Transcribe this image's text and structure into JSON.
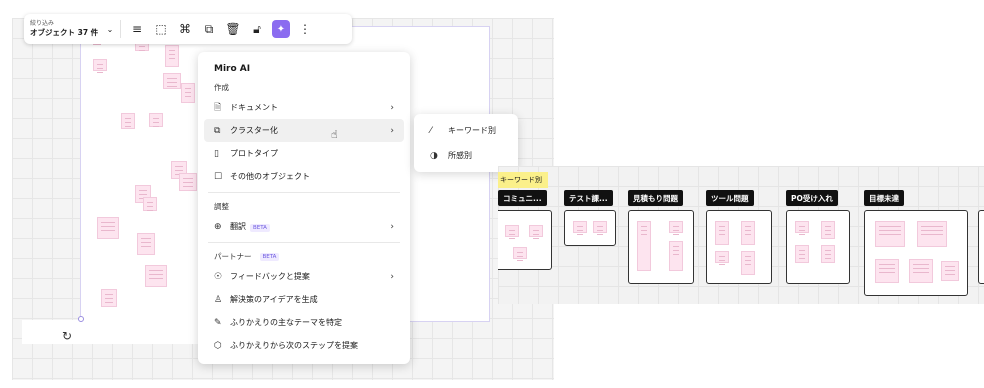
{
  "toolbar": {
    "filter_label": "絞り込み",
    "filter_count": "オブジェクト 37 件",
    "icons": [
      "chevron-down",
      "align-left",
      "select-frame",
      "format-painter",
      "duplicate",
      "delete",
      "unlock",
      "ai-sparkle",
      "more"
    ]
  },
  "ai_menu": {
    "title": "Miro AI",
    "create_section": "作成",
    "create_items": [
      {
        "label": "ドキュメント",
        "icon": "document",
        "has_submenu": true
      },
      {
        "label": "クラスター化",
        "icon": "cluster",
        "has_submenu": true
      },
      {
        "label": "プロトタイプ",
        "icon": "prototype",
        "has_submenu": false
      },
      {
        "label": "その他のオブジェクト",
        "icon": "other-objects",
        "has_submenu": false
      }
    ],
    "adjust_section": "調整",
    "translate_label": "翻訳",
    "translate_badge": "BETA",
    "partner_section": "パートナー",
    "partner_badge": "BETA",
    "partner_items": [
      {
        "label": "フィードバックと提案",
        "icon": "feedback",
        "has_submenu": true
      },
      {
        "label": "解決策のアイデアを生成",
        "icon": "lightbulb",
        "has_submenu": false
      },
      {
        "label": "ふりかえりの主なテーマを特定",
        "icon": "pen",
        "has_submenu": false
      },
      {
        "label": "ふりかえりから次のステップを提案",
        "icon": "steps",
        "has_submenu": false
      }
    ]
  },
  "submenu": {
    "items": [
      {
        "label": "キーワード別",
        "icon": "magic-wand"
      },
      {
        "label": "所感別",
        "icon": "sentiment"
      }
    ]
  },
  "clusters": {
    "tag": "キーワード別",
    "labels": [
      "コミュニ...",
      "テスト課...",
      "見積もり問題",
      "ツール問題",
      "PO受け入れ",
      "目標未達"
    ]
  },
  "colors": {
    "accent": "#8b6cf0",
    "sticky_pink": "#fde4ef",
    "cluster_label_bg": "#111111",
    "cluster_tag_bg": "#fbf08a"
  }
}
